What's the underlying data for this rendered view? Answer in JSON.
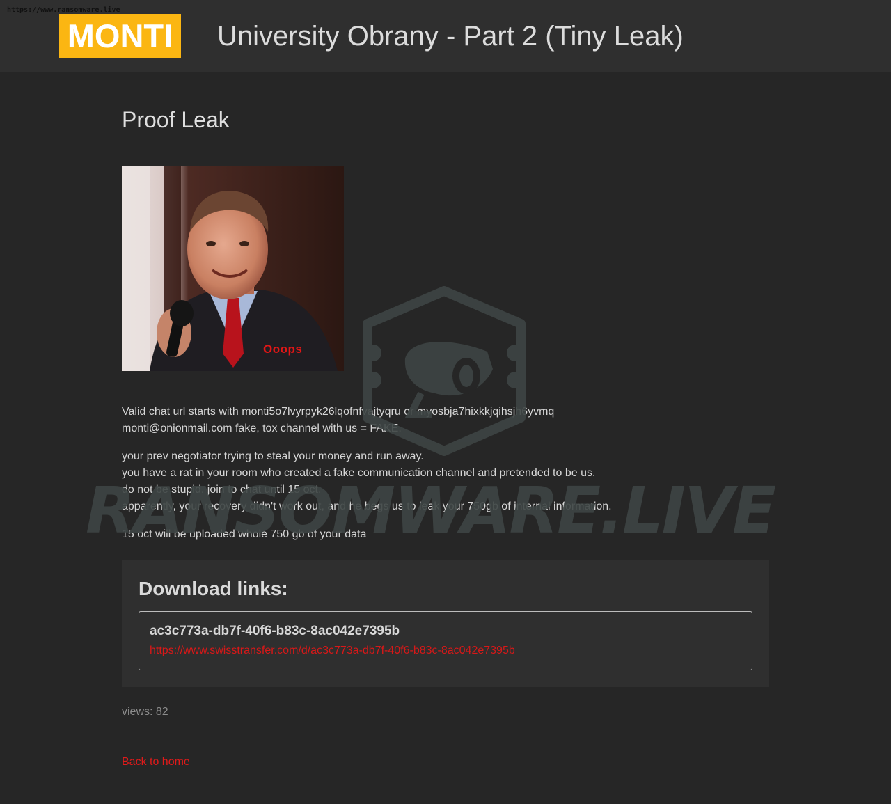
{
  "source_url": "https://www.ransomware.live",
  "header": {
    "logo": "MONTI",
    "title": "University Obrany - Part 2 (Tiny Leak)"
  },
  "main": {
    "section_title": "Proof Leak",
    "image_caption": "Ooops",
    "paragraphs": [
      {
        "lines": [
          "Valid chat url starts with monti5o7lvyrpyk26lqofnfvajtyqru or myosbja7hixkkjqihsjh6yvmq",
          "monti@onionmail.com fake, tox channel with us = FAKE."
        ]
      },
      {
        "lines": [
          "your prev negotiator trying to steal your money and run away.",
          "you have a rat in your room who created a fake communication channel and pretended to be us.",
          "do not be stupid. join to chat until 15 oct.",
          "apparently, your recovery didn't work out, and he begs us to leak your 750gb of internal information."
        ]
      },
      {
        "lines": [
          "15 oct will be uploaded whole 750 gb of your data"
        ]
      }
    ],
    "downloads": {
      "title": "Download links:",
      "items": [
        {
          "id": "ac3c773a-db7f-40f6-b83c-8ac042e7395b",
          "url": "https://www.swisstransfer.com/d/ac3c773a-db7f-40f6-b83c-8ac042e7395b"
        }
      ]
    },
    "views": "views: 82",
    "back_link": "Back to home"
  },
  "watermark": {
    "text": "RANSOMWARE.LIVE"
  },
  "colors": {
    "page_bg": "#262626",
    "header_bg": "#2f2f2f",
    "logo_bg": "#fbb612",
    "link_red": "#e01a1a",
    "watermark": "#3e4544"
  }
}
